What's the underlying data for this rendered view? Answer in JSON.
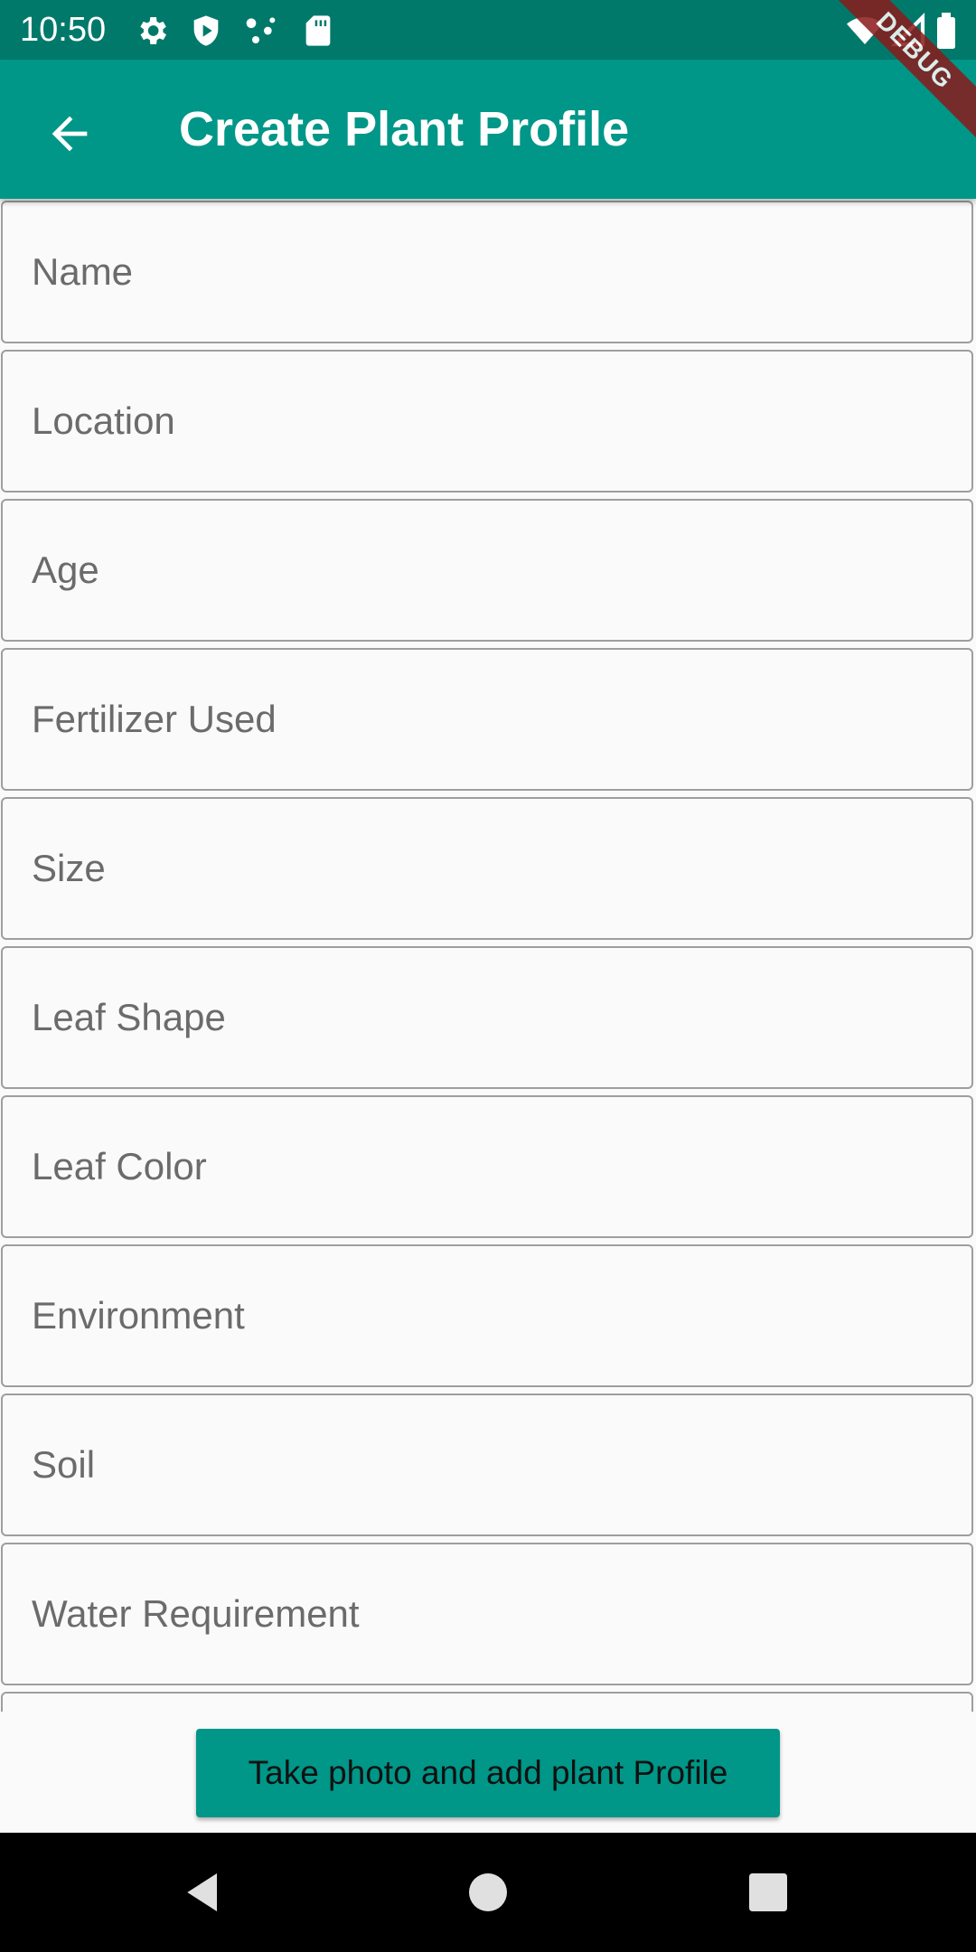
{
  "status_bar": {
    "time": "10:50",
    "background": "#00796b",
    "left_icons": [
      "settings-icon",
      "shield-icon",
      "share-dots-icon",
      "sd-card-icon"
    ],
    "right_icons": [
      "wifi-icon",
      "signal-icon",
      "battery-icon"
    ]
  },
  "app_bar": {
    "title": "Create Plant Profile",
    "background": "#009688",
    "back_icon": "arrow-back-icon"
  },
  "debug_banner": {
    "label": "DEBUG",
    "color": "#8b1a1a"
  },
  "form": {
    "fields": [
      {
        "placeholder": "Name",
        "value": ""
      },
      {
        "placeholder": "Location",
        "value": ""
      },
      {
        "placeholder": "Age",
        "value": ""
      },
      {
        "placeholder": "Fertilizer Used",
        "value": ""
      },
      {
        "placeholder": "Size",
        "value": ""
      },
      {
        "placeholder": "Leaf Shape",
        "value": ""
      },
      {
        "placeholder": "Leaf Color",
        "value": ""
      },
      {
        "placeholder": "Environment",
        "value": ""
      },
      {
        "placeholder": "Soil",
        "value": ""
      },
      {
        "placeholder": "Water Requirement",
        "value": ""
      },
      {
        "placeholder": "",
        "value": ""
      }
    ]
  },
  "action": {
    "submit_label": "Take photo and add plant Profile",
    "button_color": "#009688"
  },
  "nav_bar": {
    "buttons": [
      "back-triangle-icon",
      "home-circle-icon",
      "recents-square-icon"
    ]
  }
}
